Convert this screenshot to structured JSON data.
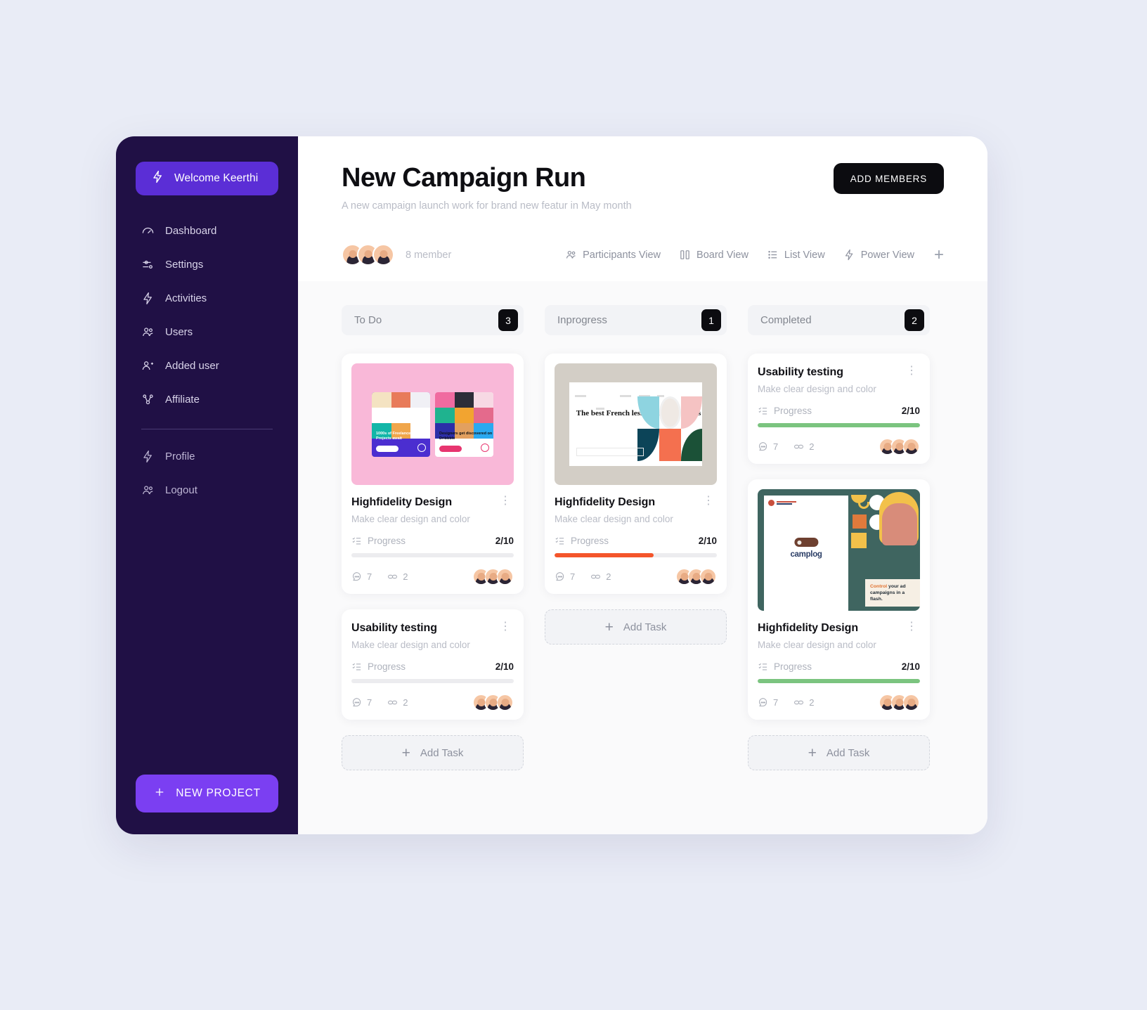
{
  "sidebar": {
    "welcome": {
      "label": "Welcome Keerthi",
      "icon": "bolt-icon"
    },
    "items": [
      {
        "label": "Dashboard",
        "icon": "gauge-icon"
      },
      {
        "label": "Settings",
        "icon": "sliders-icon"
      },
      {
        "label": "Activities",
        "icon": "bolt-icon"
      },
      {
        "label": "Users",
        "icon": "users-icon"
      },
      {
        "label": "Added user",
        "icon": "user-plus-icon"
      },
      {
        "label": "Affiliate",
        "icon": "affiliate-icon"
      }
    ],
    "secondary_items": [
      {
        "label": "Profile",
        "icon": "bolt-icon"
      },
      {
        "label": "Logout",
        "icon": "users-icon"
      }
    ],
    "new_project_label": "NEW PROJECT",
    "accent": "#7b3ff2",
    "background": "#201045"
  },
  "header": {
    "title": "New Campaign Run",
    "subtitle": "A new campaign launch work for brand new featur in May month",
    "add_members_label": "ADD MEMBERS",
    "member_count": "8 member",
    "views": [
      {
        "label": "Participants View",
        "icon": "users-icon"
      },
      {
        "label": "Board View",
        "icon": "columns-icon"
      },
      {
        "label": "List View",
        "icon": "list-icon"
      },
      {
        "label": "Power View",
        "icon": "bolt-icon"
      }
    ],
    "add_view_label": "+"
  },
  "board": {
    "add_task_label": "Add Task",
    "columns": [
      {
        "title": "To Do",
        "count": "3",
        "has_add_task": true,
        "cards": [
          {
            "title": "Highfidelity Design",
            "subtitle": "Make clear design and color",
            "progress_label": "Progress",
            "progress_value": "2/10",
            "progress_percent": 0,
            "progress_color": "#ececef",
            "comments": "7",
            "links": "2",
            "thumb": "dribbble",
            "thumb_texts": [
              "1000s of Freelance Design Projects await",
              "Designers get discovered on Dribbble"
            ]
          },
          {
            "title": "Usability testing",
            "subtitle": "Make clear design and color",
            "progress_label": "Progress",
            "progress_value": "2/10",
            "progress_percent": 0,
            "progress_color": "#ececef",
            "comments": "7",
            "links": "2",
            "thumb": "none"
          }
        ]
      },
      {
        "title": "Inprogress",
        "count": "1",
        "has_add_task": true,
        "cards": [
          {
            "title": "Highfidelity Design",
            "subtitle": "Make clear design and color",
            "progress_label": "Progress",
            "progress_value": "2/10",
            "progress_percent": 61,
            "progress_color": "#f4552b",
            "comments": "7",
            "links": "2",
            "thumb": "french",
            "thumb_texts": [
              "The best French lesson are with Anaïs"
            ]
          }
        ]
      },
      {
        "title": "Completed",
        "count": "2",
        "has_add_task": true,
        "cards": [
          {
            "title": "Usability testing",
            "subtitle": "Make clear design and color",
            "progress_label": "Progress",
            "progress_value": "2/10",
            "progress_percent": 100,
            "progress_color": "#7bc47f",
            "comments": "7",
            "links": "2",
            "thumb": "none"
          },
          {
            "title": "Highfidelity Design",
            "subtitle": "Make clear design and color",
            "progress_label": "Progress",
            "progress_value": "2/10",
            "progress_percent": 100,
            "progress_color": "#7bc47f",
            "comments": "7",
            "links": "2",
            "thumb": "camplog",
            "thumb_texts": [
              "camplog",
              "Control your ad campaigns in a flash."
            ]
          }
        ]
      }
    ]
  }
}
